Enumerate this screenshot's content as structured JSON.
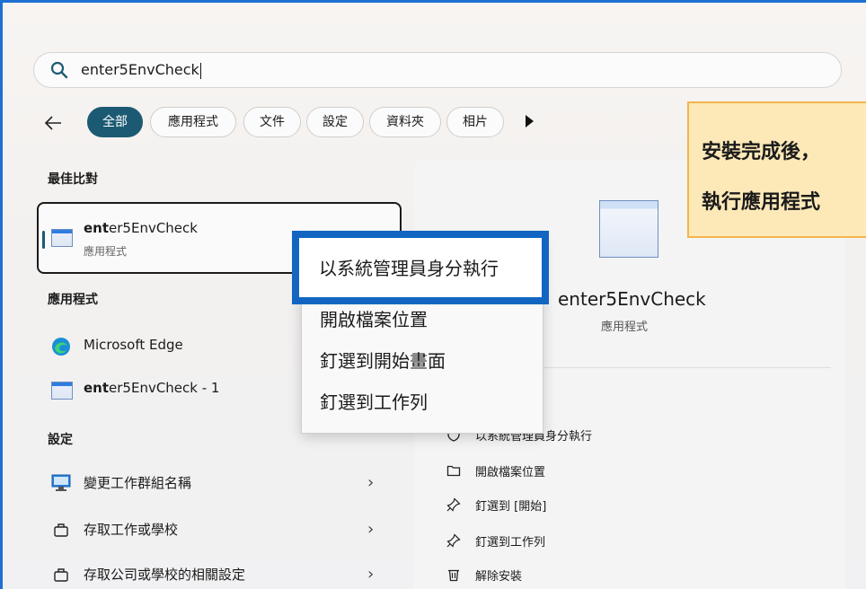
{
  "search": {
    "query": "enter5EnvCheck"
  },
  "filters": {
    "back_label": "←",
    "tabs": [
      "全部",
      "應用程式",
      "文件",
      "設定",
      "資料夾",
      "相片"
    ]
  },
  "best_match": {
    "section_title": "最佳比對",
    "name_bold": "ent",
    "name_rest": "er5EnvCheck",
    "sub": "應用程式"
  },
  "apps": {
    "section_title": "應用程式",
    "items": [
      {
        "name": "Microsoft Edge",
        "bold": "",
        "rest": "Microsoft Edge"
      },
      {
        "name": "enter5EnvCheck - 1",
        "bold": "ent",
        "rest": "er5EnvCheck - 1"
      }
    ]
  },
  "settings": {
    "section_title": "設定",
    "items": [
      {
        "label": "變更工作群組名稱",
        "chevron": "›"
      },
      {
        "label": "存取工作或學校",
        "chevron": "›"
      },
      {
        "label": "存取公司或學校的相關設定",
        "chevron": "›"
      }
    ]
  },
  "details": {
    "app_name": "enter5EnvCheck",
    "app_type": "應用程式",
    "actions": [
      {
        "label": "以系統管理員身分執行",
        "icon": "shield-icon"
      },
      {
        "label": "開啟檔案位置",
        "icon": "folder-icon"
      },
      {
        "label": "釘選到 [開始]",
        "icon": "pin-icon"
      },
      {
        "label": "釘選到工作列",
        "icon": "pin-icon"
      },
      {
        "label": "解除安裝",
        "icon": "trash-icon"
      }
    ]
  },
  "context_menu": {
    "items": [
      "以系統管理員身分執行",
      "開啟檔案位置",
      "釘選到開始畫面",
      "釘選到工作列"
    ]
  },
  "callout": {
    "line1": "安裝完成後，",
    "line2": "執行應用程式"
  },
  "colors": {
    "accent": "#1c5a73",
    "highlight_border": "#1266c2",
    "callout_bg": "#fde9b8",
    "callout_border": "#f3b54d"
  }
}
